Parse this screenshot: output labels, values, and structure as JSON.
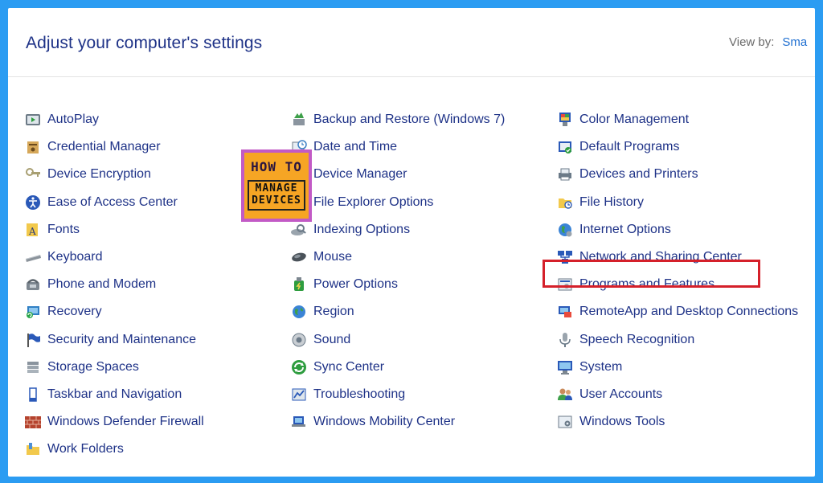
{
  "header": {
    "title": "Adjust your computer's settings",
    "view_by_label": "View by:",
    "view_by_value": "Sma"
  },
  "watermark": {
    "line1": "HOW TO",
    "line2": "MANAGE",
    "line3": "DEVICES"
  },
  "columns": [
    [
      {
        "label": "AutoPlay",
        "icon": "autoplay-icon"
      },
      {
        "label": "Credential Manager",
        "icon": "credential-manager-icon"
      },
      {
        "label": "Device Encryption",
        "icon": "device-encryption-icon"
      },
      {
        "label": "Ease of Access Center",
        "icon": "ease-of-access-icon"
      },
      {
        "label": "Fonts",
        "icon": "fonts-icon"
      },
      {
        "label": "Keyboard",
        "icon": "keyboard-icon"
      },
      {
        "label": "Phone and Modem",
        "icon": "phone-modem-icon"
      },
      {
        "label": "Recovery",
        "icon": "recovery-icon"
      },
      {
        "label": "Security and Maintenance",
        "icon": "security-flag-icon"
      },
      {
        "label": "Storage Spaces",
        "icon": "storage-spaces-icon"
      },
      {
        "label": "Taskbar and Navigation",
        "icon": "taskbar-icon"
      },
      {
        "label": "Windows Defender Firewall",
        "icon": "firewall-icon"
      },
      {
        "label": "Work Folders",
        "icon": "work-folders-icon"
      }
    ],
    [
      {
        "label": "Backup and Restore (Windows 7)",
        "icon": "backup-restore-icon"
      },
      {
        "label": "Date and Time",
        "icon": "date-time-icon"
      },
      {
        "label": "Device Manager",
        "icon": "device-manager-icon"
      },
      {
        "label": "File Explorer Options",
        "icon": "file-explorer-options-icon"
      },
      {
        "label": "Indexing Options",
        "icon": "indexing-options-icon"
      },
      {
        "label": "Mouse",
        "icon": "mouse-icon"
      },
      {
        "label": "Power Options",
        "icon": "power-options-icon"
      },
      {
        "label": "Region",
        "icon": "region-globe-icon"
      },
      {
        "label": "Sound",
        "icon": "sound-icon"
      },
      {
        "label": "Sync Center",
        "icon": "sync-center-icon"
      },
      {
        "label": "Troubleshooting",
        "icon": "troubleshooting-icon"
      },
      {
        "label": "Windows Mobility Center",
        "icon": "mobility-center-icon"
      }
    ],
    [
      {
        "label": "Color Management",
        "icon": "color-management-icon"
      },
      {
        "label": "Default Programs",
        "icon": "default-programs-icon"
      },
      {
        "label": "Devices and Printers",
        "icon": "devices-printers-icon"
      },
      {
        "label": "File History",
        "icon": "file-history-icon"
      },
      {
        "label": "Internet Options",
        "icon": "internet-options-icon"
      },
      {
        "label": "Network and Sharing Center",
        "icon": "network-sharing-icon"
      },
      {
        "label": "Programs and Features",
        "icon": "programs-features-icon"
      },
      {
        "label": "RemoteApp and Desktop Connections",
        "icon": "remoteapp-icon"
      },
      {
        "label": "Speech Recognition",
        "icon": "microphone-icon"
      },
      {
        "label": "System",
        "icon": "system-monitor-icon"
      },
      {
        "label": "User Accounts",
        "icon": "user-accounts-icon"
      },
      {
        "label": "Windows Tools",
        "icon": "windows-tools-icon"
      }
    ]
  ],
  "colors": {
    "frame": "#2b9cf2",
    "link": "#1e3287",
    "highlight": "#d5202a"
  }
}
